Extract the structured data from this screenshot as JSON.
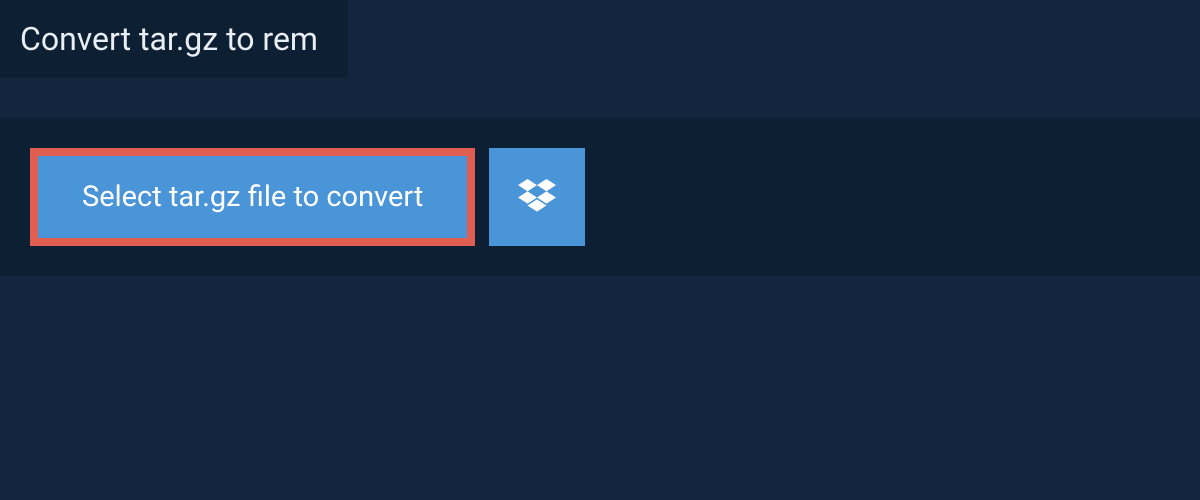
{
  "header": {
    "title": "Convert tar.gz to rem"
  },
  "upload": {
    "select_label": "Select tar.gz file to convert"
  },
  "colors": {
    "background": "#12273f",
    "panel": "#0d1f33",
    "button": "#4a94d8",
    "button_border": "#e05d52",
    "text_light": "#ffffff",
    "text_header": "#e8eef4"
  }
}
